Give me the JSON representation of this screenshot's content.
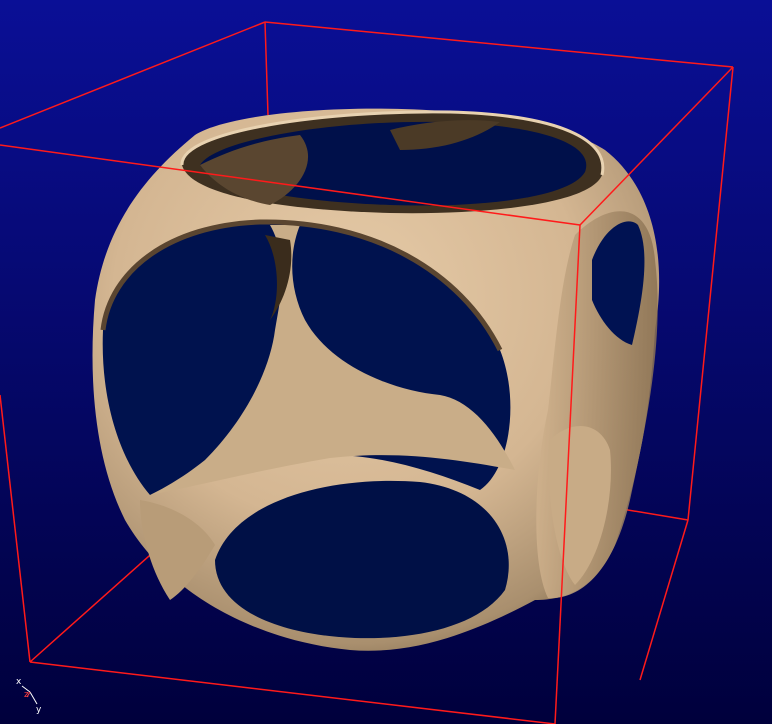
{
  "viewport": {
    "background_top": "#0a0f96",
    "background_bottom": "#00003c"
  },
  "bounding_box": {
    "color": "#ff1a1a"
  },
  "model": {
    "shape": "hollowed-cube-sphere-intersection",
    "color_light": "#dcbf9c",
    "color_mid": "#b79f7f",
    "color_dark": "#4a3b28"
  },
  "axis_triad": {
    "x_label": "x",
    "y_label": "y",
    "z_label": "z",
    "x_color": "#ffffff",
    "y_color": "#ffffff",
    "z_color": "#ff4040"
  }
}
